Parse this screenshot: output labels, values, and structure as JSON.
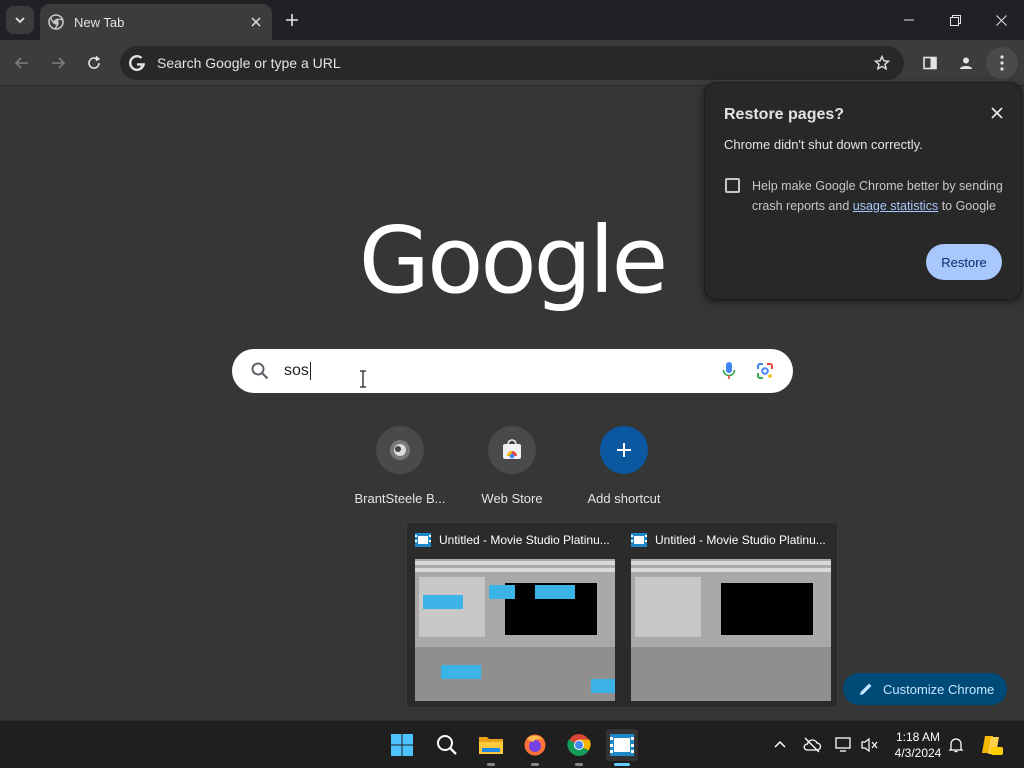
{
  "browser": {
    "tab_title": "New Tab",
    "omnibox_placeholder": "Search Google or type a URL"
  },
  "ntp": {
    "logo_text": "Google",
    "search_value": "sos",
    "shortcuts": [
      {
        "label": "BrantSteele B..."
      },
      {
        "label": "Web Store"
      },
      {
        "label": "Add shortcut"
      }
    ],
    "customize_label": "Customize Chrome"
  },
  "restore_popup": {
    "title": "Restore pages?",
    "message": "Chrome didn't shut down correctly.",
    "help_text_before": "Help make Google Chrome better by sending crash reports and ",
    "help_link": "usage statistics",
    "help_text_after": " to Google",
    "restore_label": "Restore"
  },
  "preview": {
    "windows": [
      {
        "title": "Untitled - Movie Studio Platinu..."
      },
      {
        "title": "Untitled - Movie Studio Platinu..."
      }
    ]
  },
  "taskbar": {
    "time": "1:18 AM",
    "date": "4/3/2024"
  },
  "colors": {
    "page_bg": "#363636",
    "toolbar_bg": "#3c3c3c",
    "accent_button": "#a8c7fa",
    "customize_bg": "#004a77",
    "add_shortcut_bg": "#0b57a0"
  }
}
